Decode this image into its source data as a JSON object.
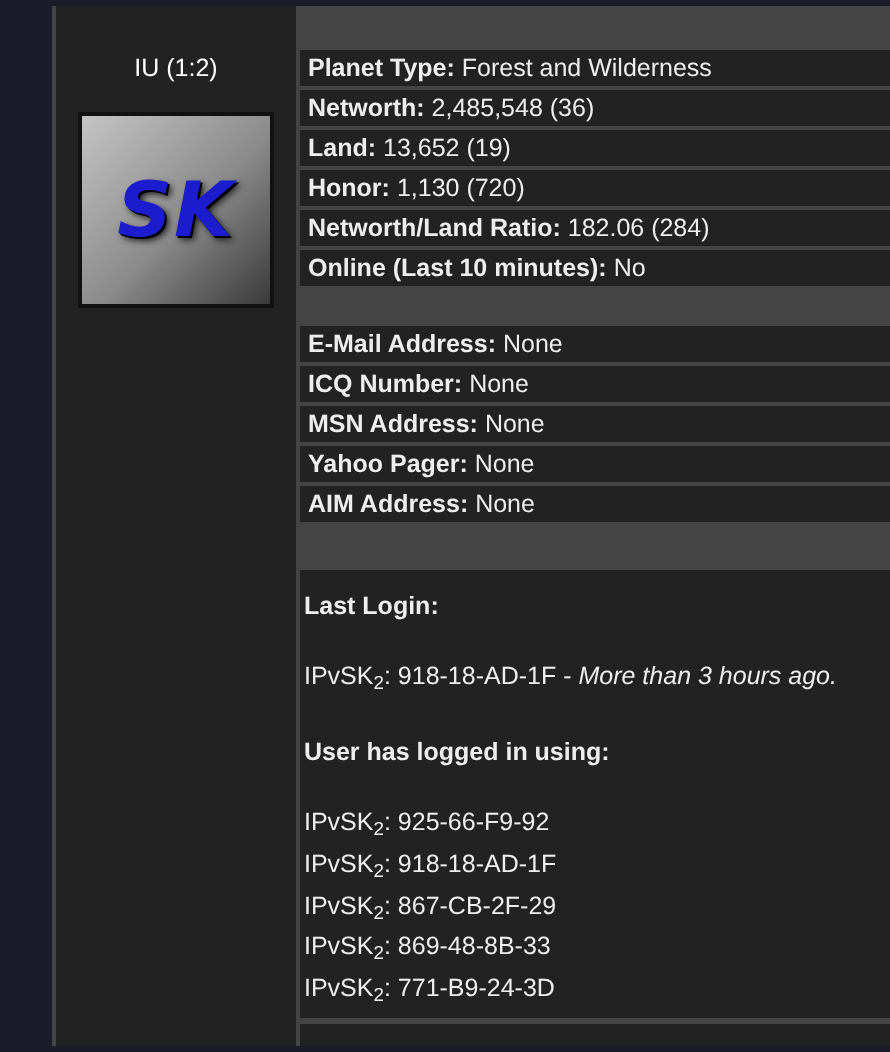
{
  "player": {
    "name": "IU (1:2)",
    "logo": "SK"
  },
  "profile_sections": [
    {
      "rows": [
        "**Planet Type:** Forest and Wilderness",
        "**Networth:** 2,485,548 (36)",
        "**Land:** 13,652 (19)",
        "**Honor:** 1,130 (720)",
        "**Networth/Land Ratio:** 182.06 (284)",
        "**Online (Last 10 minutes):** No"
      ]
    },
    {
      "rows": [
        "**E-Mail Address:** None",
        "**ICQ Number:** None",
        "**MSN Address:** None",
        "**Yahoo Pager:** None",
        "**AIM Address:** None"
      ]
    }
  ],
  "last_login": {
    "heading": "Last Login:",
    "entry": "IPvSK$_{2}$: 918-18-AD-1F - *More than 3 hours ago.*"
  },
  "history": {
    "heading": "User has logged in using:",
    "entries": [
      "IPvSK$_{2}$: 925-66-F9-92",
      "IPvSK$_{2}$: 918-18-AD-1F",
      "IPvSK$_{2}$: 867-CB-2F-29",
      "IPvSK$_{2}$: 869-48-8B-33",
      "IPvSK$_{2}$: 771-B9-24-3D"
    ]
  }
}
